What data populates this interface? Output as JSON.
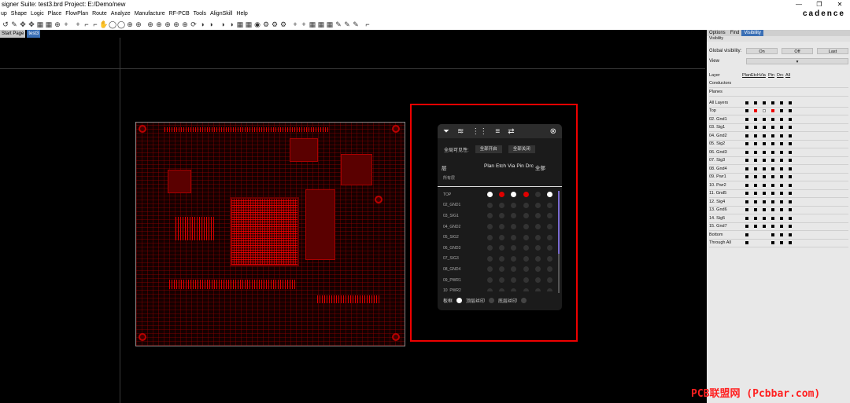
{
  "window": {
    "title": "signer Suite: test3.brd  Project: E:/Demo/new",
    "controls": [
      "—",
      "❐",
      "✕"
    ],
    "brand": "cadence"
  },
  "menu": [
    "up",
    "Shape",
    "Logic",
    "Place",
    "FlowPlan",
    "Route",
    "Analyze",
    "Manufacture",
    "RF-PCB",
    "Tools",
    "AlignSkill",
    "Help"
  ],
  "toolbar_icons": [
    "undo-icon",
    "pin-icon",
    "move-icon",
    "grid-icon",
    "zoom-icon",
    "add-icon",
    "route-icon",
    "hand-icon",
    "circle-icon",
    "refresh-icon",
    "color-icon",
    "eye-icon",
    "gear-icon"
  ],
  "tabs": [
    "Start Page",
    "test3"
  ],
  "popup": {
    "global_label": "全局可见性:",
    "all_on": "全部开启",
    "all_off": "全部关闭",
    "layer_col": "层",
    "columns": [
      "Plan",
      "Etch",
      "Via",
      "Pin",
      "Drc",
      "全部"
    ],
    "all_layers": "所有层",
    "layers": [
      {
        "name": "TOP",
        "states": [
          "w",
          "r",
          "w",
          "r",
          "o",
          "w"
        ]
      },
      {
        "name": "02_GND1",
        "states": [
          "o",
          "o",
          "o",
          "o",
          "o",
          "o"
        ]
      },
      {
        "name": "03_SIG1",
        "states": [
          "o",
          "o",
          "o",
          "o",
          "o",
          "o"
        ]
      },
      {
        "name": "04_GND2",
        "states": [
          "o",
          "o",
          "o",
          "o",
          "o",
          "o"
        ]
      },
      {
        "name": "05_SIG2",
        "states": [
          "o",
          "o",
          "o",
          "o",
          "o",
          "o"
        ]
      },
      {
        "name": "06_GND3",
        "states": [
          "o",
          "o",
          "o",
          "o",
          "o",
          "o"
        ]
      },
      {
        "name": "07_SIG3",
        "states": [
          "o",
          "o",
          "o",
          "o",
          "o",
          "o"
        ]
      },
      {
        "name": "08_GND4",
        "states": [
          "o",
          "o",
          "o",
          "o",
          "o",
          "o"
        ]
      },
      {
        "name": "09_PWR1",
        "states": [
          "o",
          "o",
          "o",
          "o",
          "o",
          "o"
        ]
      },
      {
        "name": "10_PWR2",
        "states": [
          "o",
          "o",
          "o",
          "o",
          "o",
          "o"
        ]
      }
    ],
    "footer": {
      "board": "板框",
      "top_silk": "顶层丝印",
      "bottom_silk": "底层丝印"
    }
  },
  "panel": {
    "tabs": [
      "Options",
      "Find",
      "Visibility"
    ],
    "sub": "Visibility",
    "global_label": "Global visibility:",
    "buttons": [
      "On",
      "Off",
      "Last"
    ],
    "view_label": "View",
    "layer_hdr": "Layer",
    "cols": [
      "Plan",
      "Etch",
      "Via",
      "Pin",
      "Drc",
      "All"
    ],
    "groups": [
      "Conductors",
      "Planes"
    ],
    "rows": [
      {
        "name": "All Layers",
        "s": [
          "k",
          "k",
          "k",
          "k",
          "k",
          "k"
        ]
      },
      {
        "name": "Top",
        "s": [
          "k",
          "r",
          "w",
          "r",
          "k",
          "k"
        ]
      },
      {
        "name": "02. Gnd1",
        "s": [
          "k",
          "k",
          "k",
          "k",
          "k",
          "k"
        ]
      },
      {
        "name": "03. Sig1",
        "s": [
          "k",
          "k",
          "k",
          "k",
          "k",
          "k"
        ]
      },
      {
        "name": "04. Gnd2",
        "s": [
          "k",
          "k",
          "k",
          "k",
          "k",
          "k"
        ]
      },
      {
        "name": "05. Sig2",
        "s": [
          "k",
          "k",
          "k",
          "k",
          "k",
          "k"
        ]
      },
      {
        "name": "06. Gnd3",
        "s": [
          "k",
          "k",
          "k",
          "k",
          "k",
          "k"
        ]
      },
      {
        "name": "07. Sig3",
        "s": [
          "k",
          "k",
          "k",
          "k",
          "k",
          "k"
        ]
      },
      {
        "name": "08. Gnd4",
        "s": [
          "k",
          "k",
          "k",
          "k",
          "k",
          "k"
        ]
      },
      {
        "name": "09. Pwr1",
        "s": [
          "k",
          "k",
          "k",
          "k",
          "k",
          "k"
        ]
      },
      {
        "name": "10. Pwr2",
        "s": [
          "k",
          "k",
          "k",
          "k",
          "k",
          "k"
        ]
      },
      {
        "name": "11. Gnd5",
        "s": [
          "k",
          "k",
          "k",
          "k",
          "k",
          "k"
        ]
      },
      {
        "name": "12. Sig4",
        "s": [
          "k",
          "k",
          "k",
          "k",
          "k",
          "k"
        ]
      },
      {
        "name": "13. Gnd6",
        "s": [
          "k",
          "k",
          "k",
          "k",
          "k",
          "k"
        ]
      },
      {
        "name": "14. Sig5",
        "s": [
          "k",
          "k",
          "k",
          "k",
          "k",
          "k"
        ]
      },
      {
        "name": "15. Gnd7",
        "s": [
          "k",
          "k",
          "k",
          "k",
          "k",
          "k"
        ]
      },
      {
        "name": "Bottom",
        "s": [
          "k",
          "x",
          "x",
          "k",
          "k",
          "k"
        ]
      },
      {
        "name": "Through All",
        "s": [
          "k",
          "x",
          "x",
          "k",
          "k",
          "k"
        ]
      }
    ]
  },
  "watermark": "PCB联盟网 (Pcbbar.com)"
}
